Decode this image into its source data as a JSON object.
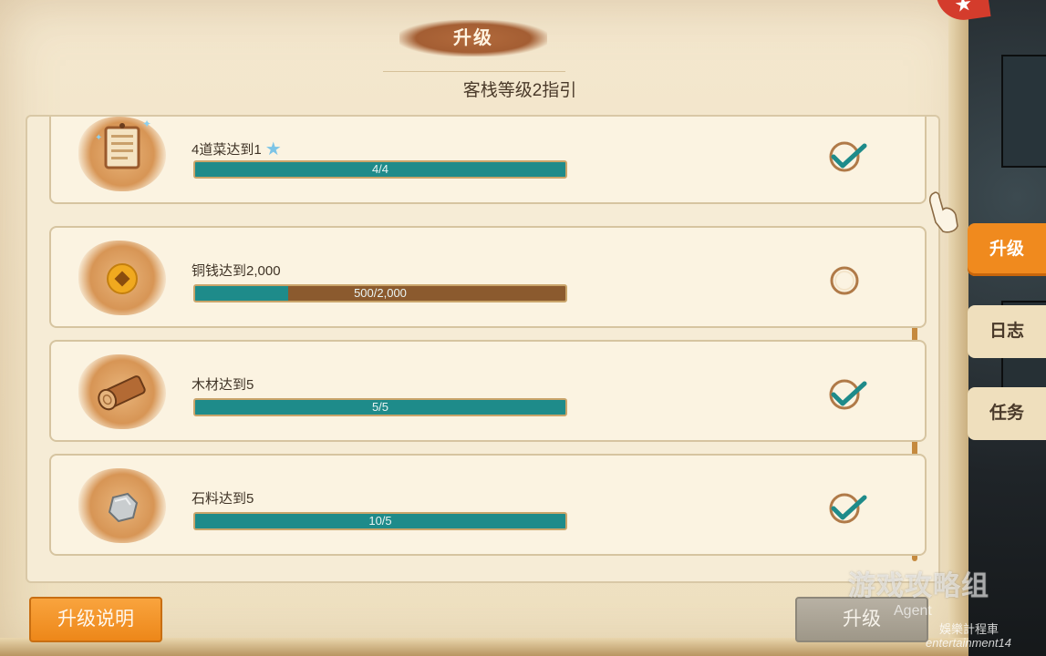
{
  "header": {
    "title": "升级",
    "subtitle": "客栈等级2指引"
  },
  "tasks": [
    {
      "label": "4道菜达到1",
      "progress": "4/4",
      "fill": 1.0,
      "completed": true,
      "icon": "menu-board-icon",
      "has_star": true
    },
    {
      "label": "铜钱达到2,000",
      "progress": "500/2,000",
      "fill": 0.25,
      "completed": false,
      "icon": "copper-coin-icon",
      "has_star": false
    },
    {
      "label": "木材达到5",
      "progress": "5/5",
      "fill": 1.0,
      "completed": true,
      "icon": "wood-log-icon",
      "has_star": false
    },
    {
      "label": "石料达到5",
      "progress": "10/5",
      "fill": 1.0,
      "completed": true,
      "icon": "stone-icon",
      "has_star": false
    }
  ],
  "side_tabs": [
    {
      "label": "升级",
      "active": true
    },
    {
      "label": "日志",
      "active": false
    },
    {
      "label": "任务",
      "active": false
    }
  ],
  "buttons": {
    "help_label": "升级说明",
    "upgrade_label": "升级"
  },
  "watermark": {
    "main": "游戏攻略组",
    "agent": "Agent",
    "cn": "娛樂計程車",
    "en": "entertainment14"
  },
  "colors": {
    "accent_orange": "#f08a1e",
    "progress_teal": "#1e8b8a",
    "progress_bg": "#8b5a2e",
    "check_teal": "#1e8b8a"
  }
}
